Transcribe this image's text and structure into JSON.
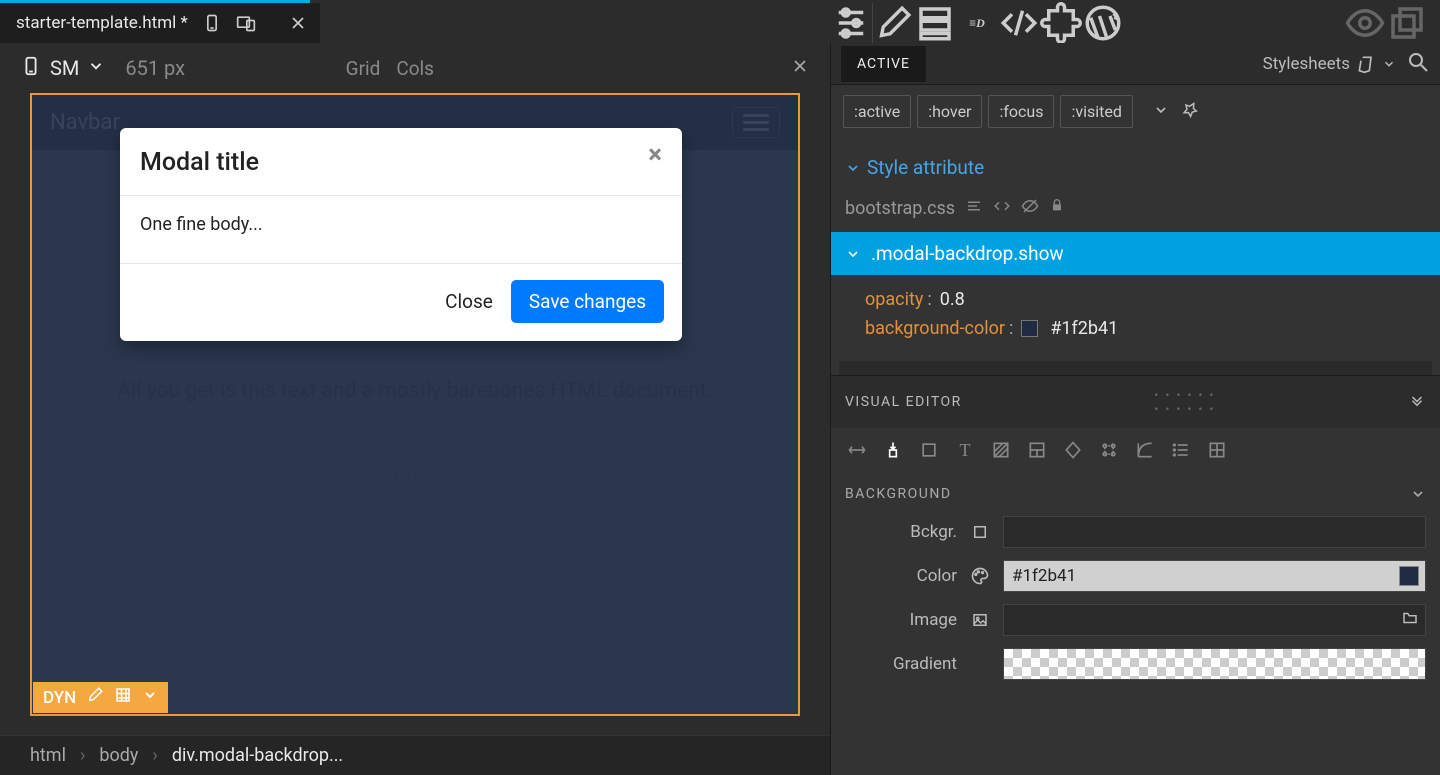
{
  "tab": {
    "filename": "starter-template.html *"
  },
  "viewport": {
    "breakpoint": "SM",
    "width": "651 px",
    "grid_label": "Grid",
    "cols_label": "Cols"
  },
  "preview": {
    "navbar_brand": "Navbar",
    "modal_title": "Modal title",
    "modal_body": "One fine body...",
    "modal_close_btn": "Close",
    "modal_save_btn": "Save changes",
    "under_text": "All you get is this text and a mostly barebones HTML document.",
    "open_btn": "Open",
    "dyn_tag": "DYN"
  },
  "breadcrumb": [
    "html",
    "body",
    "div.modal-backdrop..."
  ],
  "right": {
    "active_tab": "ACTIVE",
    "stylesheets_label": "Stylesheets",
    "pseudo": [
      ":active",
      ":hover",
      ":focus",
      ":visited"
    ],
    "style_attr_label": "Style attribute",
    "source_file": "bootstrap.css",
    "selector": ".modal-backdrop.show",
    "props": [
      {
        "k": "opacity",
        "v": "0.8",
        "swatch": null
      },
      {
        "k": "background-color",
        "v": "#1f2b41",
        "swatch": "#1f2b41"
      }
    ],
    "visual_editor_label": "VISUAL EDITOR",
    "background_section": "BACKGROUND",
    "rows": {
      "bckgr": {
        "label": "Bckgr.",
        "value": ""
      },
      "color": {
        "label": "Color",
        "value": "#1f2b41",
        "swatch": "#1f2b41"
      },
      "image": {
        "label": "Image",
        "value": ""
      },
      "gradient": {
        "label": "Gradient",
        "value": ""
      }
    }
  }
}
